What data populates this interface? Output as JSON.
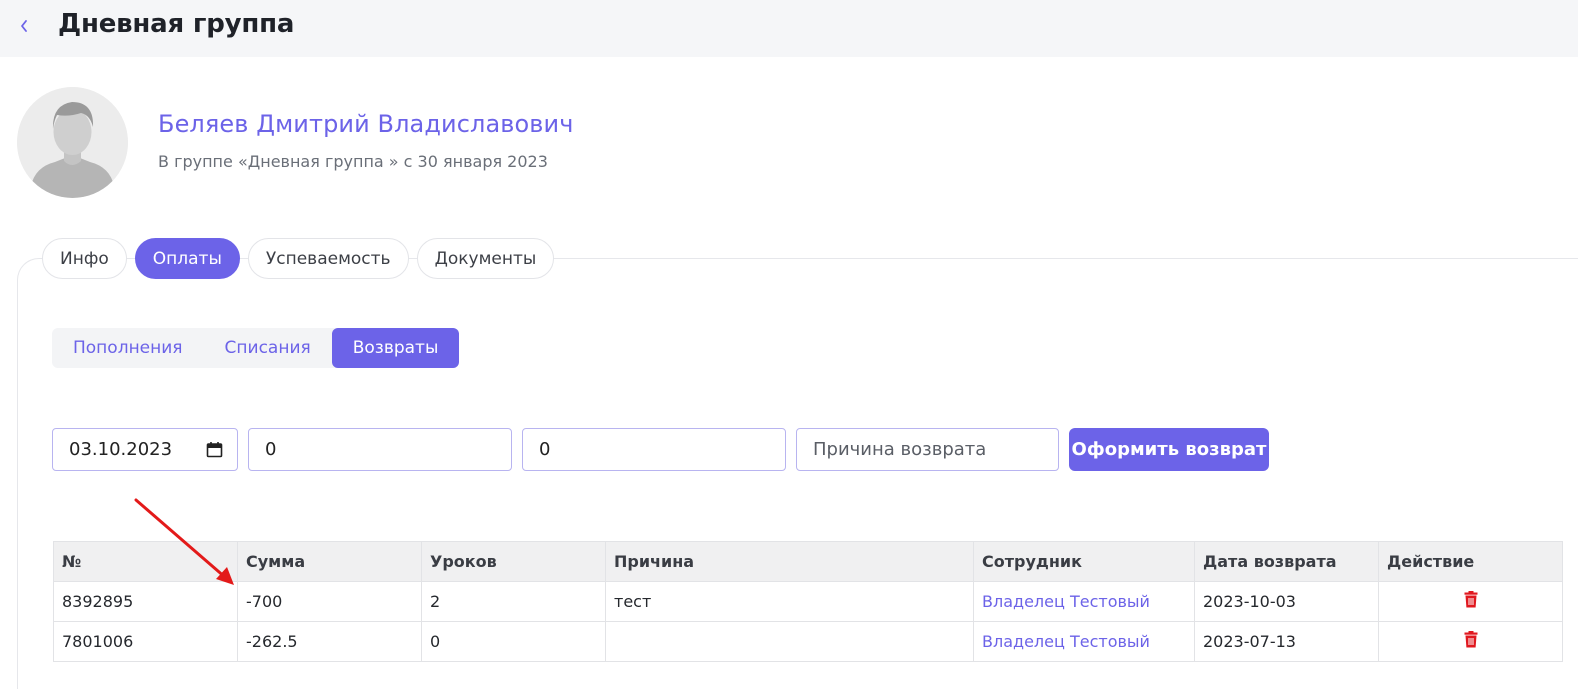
{
  "header": {
    "title": "Дневная группа",
    "back_icon": "chevron-left-icon"
  },
  "profile": {
    "name": "Беляев Дмитрий Владиславович",
    "subtitle": "В группе «Дневная группа » с 30 января 2023"
  },
  "tabs": [
    {
      "label": "Инфо",
      "active": false
    },
    {
      "label": "Оплаты",
      "active": true
    },
    {
      "label": "Успеваемость",
      "active": false
    },
    {
      "label": "Документы",
      "active": false
    }
  ],
  "subtabs": [
    {
      "label": "Пополнения",
      "active": false
    },
    {
      "label": "Списания",
      "active": false
    },
    {
      "label": "Возвраты",
      "active": true
    }
  ],
  "form": {
    "date_value": "03.10.2023",
    "amount_value": "0",
    "lessons_value": "0",
    "reason_placeholder": "Причина возврата",
    "submit_label": "Оформить возврат"
  },
  "table": {
    "headers": [
      "№",
      "Сумма",
      "Уроков",
      "Причина",
      "Сотрудник",
      "Дата возврата",
      "Действие"
    ],
    "rows": [
      [
        "8392895",
        "-700",
        "2",
        "тест",
        "Владелец Тестовый",
        "2023-10-03"
      ],
      [
        "7801006",
        "-262.5",
        "0",
        "",
        "Владелец Тестовый",
        "2023-07-13"
      ]
    ]
  },
  "colors": {
    "accent": "#6c63e8",
    "danger": "#e0181f",
    "annotation": "#e31a1a"
  }
}
